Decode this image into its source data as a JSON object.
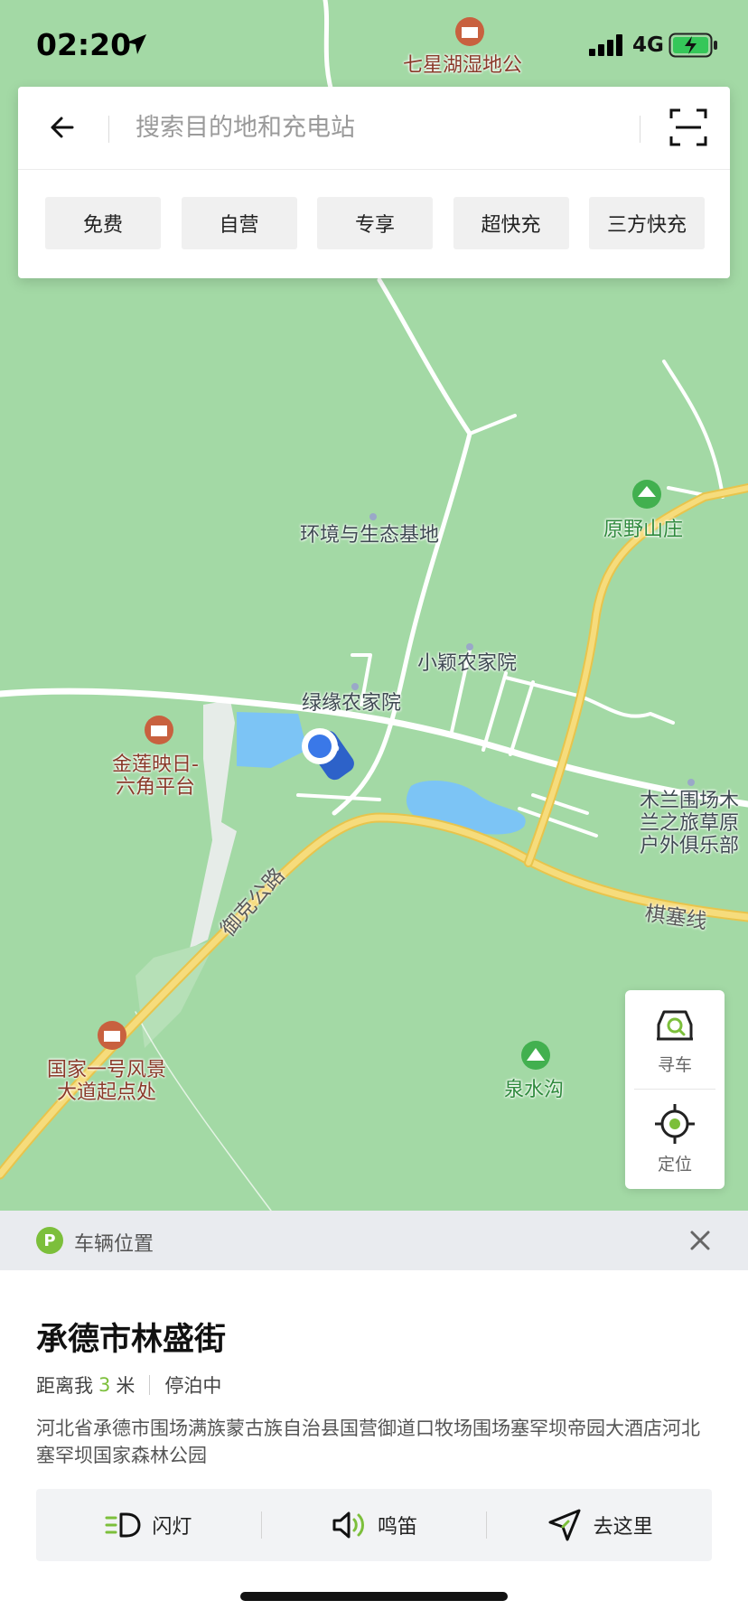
{
  "status_bar": {
    "time": "02:20",
    "network": "4G"
  },
  "search": {
    "placeholder": "搜索目的地和充电站",
    "filters": [
      "免费",
      "自营",
      "专享",
      "超快充",
      "三方快充"
    ]
  },
  "map": {
    "pois": {
      "qixinghu": "七星湖湿地公",
      "huanjing": "环境与生态基地",
      "yuanye": "原野山庄",
      "xiaoying": "小颖农家院",
      "lvyuan": "绿缘农家院",
      "jinlian": [
        "金莲映日-",
        "六角平台"
      ],
      "mulan": [
        "木兰围场木",
        "兰之旅草原",
        "户外俱乐部"
      ],
      "guojia": [
        "国家一号风景",
        "大道起点处"
      ],
      "quanshui": "泉水沟"
    },
    "roads": {
      "yuke": "御克公路",
      "qisai": "棋塞线"
    }
  },
  "fab": {
    "find_car": "寻车",
    "locate": "定位"
  },
  "sheet": {
    "header": "车辆位置",
    "badge": "P",
    "title": "承德市林盛街",
    "distance_label": "距离我",
    "distance_value": "3",
    "distance_unit": "米",
    "status": "停泊中",
    "address": "河北省承德市围场满族蒙古族自治县国营御道口牧场围场塞罕坝帝园大酒店河北塞罕坝国家森林公园",
    "actions": {
      "flash": "闪灯",
      "horn": "鸣笛",
      "navigate": "去这里"
    }
  },
  "colors": {
    "map_bg": "#a3d9a5",
    "road_major": "#f3d46a",
    "water": "#7cc4f5",
    "accent": "#7cbf3b"
  }
}
